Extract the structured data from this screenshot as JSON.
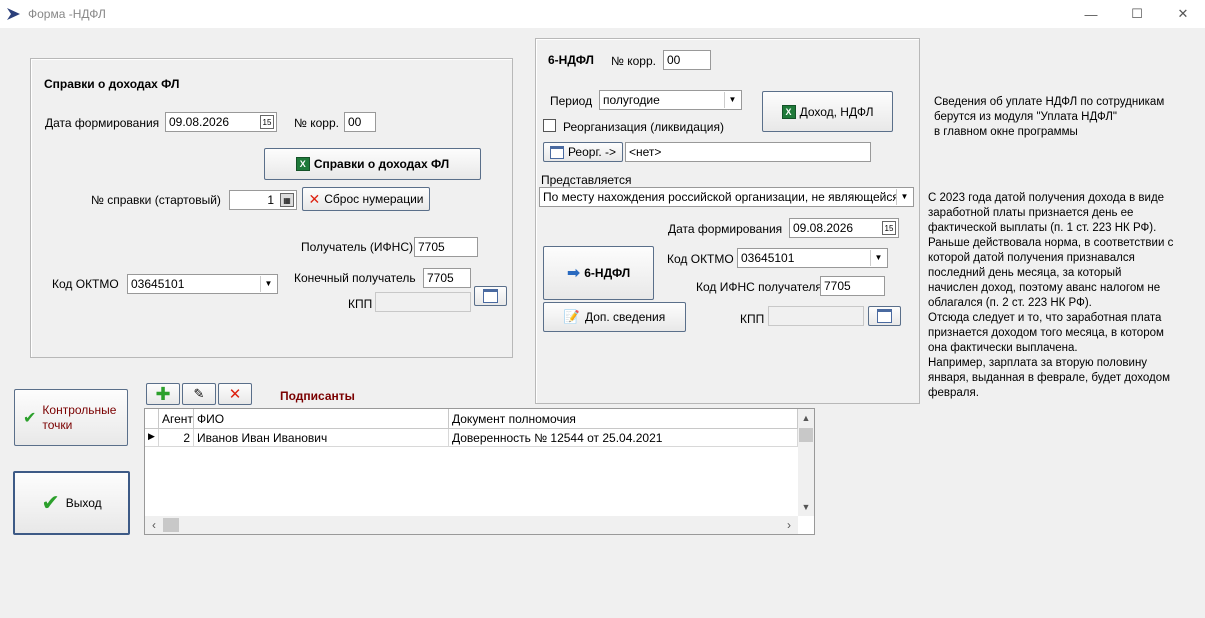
{
  "window": {
    "title": "Форма -НДФЛ",
    "minimize": "—",
    "maximize": "☐",
    "close": "✕"
  },
  "income_panel": {
    "title": "Справки о доходах ФЛ",
    "date_label": "Дата формирования",
    "date_value": "09.08.2026",
    "corr_label": "№ корр.",
    "corr_value": "00",
    "certificates_button": "Справки о доходах ФЛ",
    "cert_no_label": "№ справки (стартовый)",
    "cert_no_value": "1",
    "reset_button": "Сброс нумерации",
    "recipient_label": "Получатель (ИФНС)",
    "recipient_value": "7705",
    "oktmo_label": "Код ОКТМО",
    "oktmo_value": "03645101",
    "final_recipient_label": "Конечный получатель",
    "final_recipient_value": "7705",
    "kpp_label": "КПП",
    "kpp_value": ""
  },
  "ndfl6_panel": {
    "title": "6-НДФЛ",
    "corr_label": "№ корр.",
    "corr_value": "00",
    "period_label": "Период",
    "period_value": "полугодие",
    "income_button": "Доход, НДФЛ",
    "reorg_label": "Реорганизация (ликвидация)",
    "reorg_button": "Реорг. ->",
    "reorg_value": "<нет>",
    "presented_label": "Представляется",
    "presented_value": "По месту нахождения российской организации, не являющейся",
    "date_label": "Дата формирования",
    "date_value": "09.08.2026",
    "form_button": "6-НДФЛ",
    "oktmo_label": "Код ОКТМО",
    "oktmo_value": "03645101",
    "ifns_label": "Код ИФНС получателя",
    "ifns_value": "7705",
    "extra_button": "Доп. сведения",
    "kpp_label": "КПП",
    "kpp_value": ""
  },
  "info_note": [
    "Сведения об уплате НДФЛ по сотрудникам",
    "берутся из модуля \"Уплата НДФЛ\"",
    "в главном окне программы"
  ],
  "tax_note": [
    "С 2023 года датой получения дохода в виде",
    "заработной платы признается день ее",
    "фактической выплаты (п. 1 ст. 223 НК РФ).",
    "Раньше действовала норма, в соответствии с",
    "которой датой получения признавался",
    "последний день месяца, за который",
    "начислен доход, поэтому аванс налогом не",
    "облагался (п. 2 ст. 223 НК РФ).",
    "Отсюда следует и то, что заработная плата",
    "признается доходом того месяца, в котором",
    "она фактически выплачена.",
    "Например, зарплата за вторую половину",
    "января, выданная в феврале, будет доходом",
    "февраля."
  ],
  "checkpoints_button": [
    "Контрольные",
    "точки"
  ],
  "exit_button": "Выход",
  "signers": {
    "title": "Подписанты",
    "columns": [
      "Агент",
      "ФИО",
      "Документ полномочия"
    ],
    "rows": [
      {
        "agent": "2",
        "name": "Иванов Иван Иванович",
        "document": "Доверенность № 12544 от 25.04.2021"
      }
    ]
  },
  "colors": {
    "signers_title": "#7a0000",
    "checkpoints_text": "#7a0000",
    "accent_border": "#5a6f8a"
  }
}
